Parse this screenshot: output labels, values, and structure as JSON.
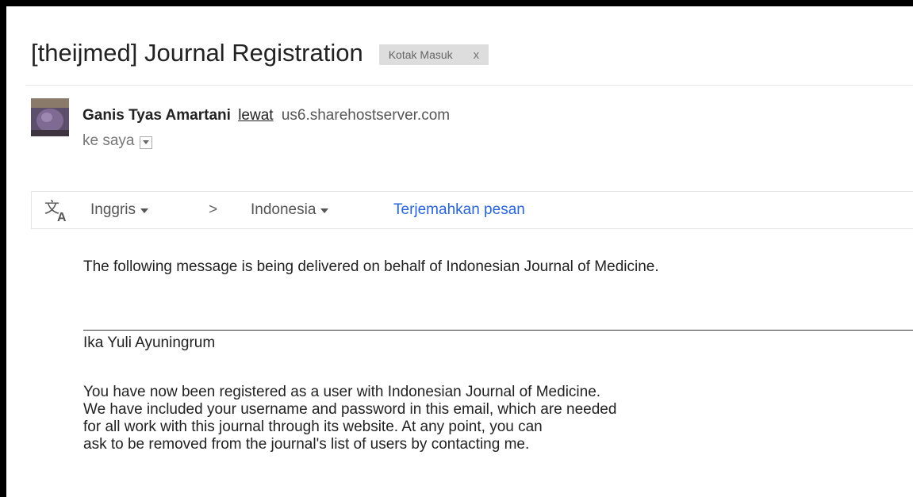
{
  "email": {
    "subject": "[theijmed] Journal Registration",
    "label": {
      "text": "Kotak Masuk",
      "remove": "x"
    },
    "sender": {
      "name": "Ganis Tyas Amartani",
      "via_word": "lewat",
      "via_host": "us6.sharehostserver.com"
    },
    "recipient": "ke saya",
    "translate": {
      "icon": "translate-icon",
      "from_lang": "Inggris",
      "separator": ">",
      "to_lang": "Indonesia",
      "action": "Terjemahkan pesan"
    },
    "body": {
      "intro": "The following message is being delivered on behalf of Indonesian Journal of Medicine.",
      "signer": "Ika Yuli Ayuningrum",
      "lines": [
        "You have now been registered as a user with Indonesian Journal of Medicine.",
        "We have included your username and password in this email, which are needed",
        "for all work with this journal through its website. At any point, you can",
        "ask to be removed from the journal's list of users by contacting me."
      ]
    }
  },
  "colors": {
    "link_blue": "#2a65d8",
    "chip_bg": "#dddddd",
    "text": "#222222"
  }
}
